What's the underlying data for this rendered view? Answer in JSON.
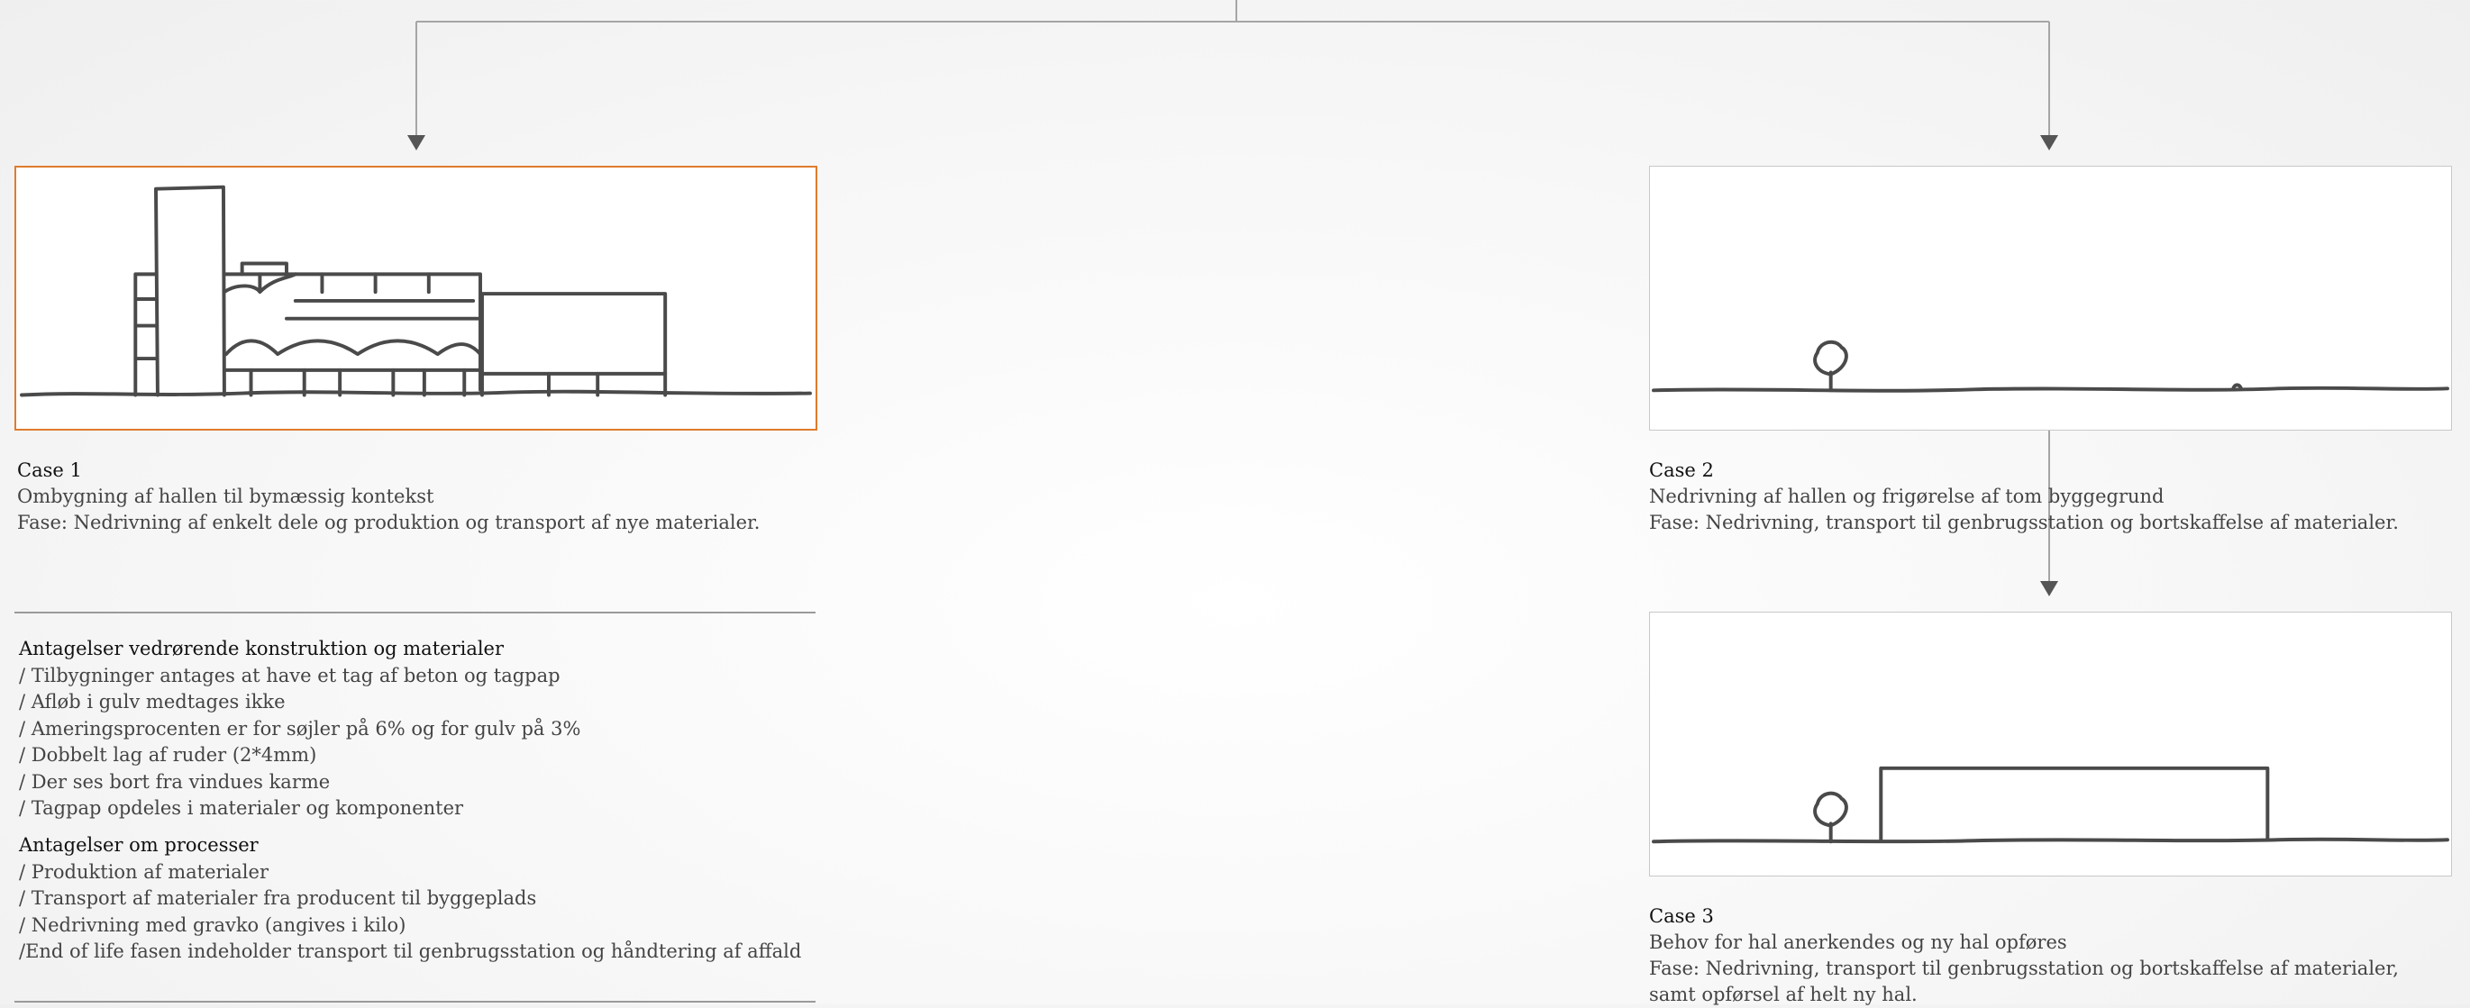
{
  "colors": {
    "accent": "#e07b2c",
    "line": "#999999",
    "text": "#444444",
    "sketch": "#4a4a4a"
  },
  "cases": [
    {
      "title": "Case 1",
      "lines": [
        "Ombygning af hallen til bymæssig kontekst",
        "Fase: Nedrivning af enkelt dele og produktion og transport af nye materialer."
      ]
    },
    {
      "title": "Case 2",
      "lines": [
        "Nedrivning af hallen og frigørelse af tom byggegrund",
        "Fase: Nedrivning, transport til genbrugsstation og bortskaffelse af materialer."
      ]
    },
    {
      "title": "Case 3",
      "lines": [
        "Behov for hal anerkendes og ny hal opføres",
        "Fase: Nedrivning, transport til genbrugsstation og bortskaffelse af materialer,",
        "samt opførsel af helt ny hal."
      ]
    }
  ],
  "assumptions": {
    "construction": {
      "heading": "Antagelser vedrørende konstruktion og materialer",
      "items": [
        "/ Tilbygninger antages at have et tag af beton og tagpap",
        "/ Afløb i gulv medtages ikke",
        "/ Ameringsprocenten er for søjler på 6% og for gulv på 3%",
        "/ Dobbelt lag af ruder (2*4mm)",
        "/ Der ses bort fra vindues karme",
        "/ Tagpap opdeles i materialer og komponenter"
      ]
    },
    "processes": {
      "heading": "Antagelser om processer",
      "items": [
        "/ Produktion af materialer",
        "/ Transport af materialer fra producent til byggeplads",
        "/ Nedrivning med gravko (angives i kilo)",
        "/End of life fasen indeholder transport til genbrugsstation og håndtering af affald"
      ]
    }
  }
}
